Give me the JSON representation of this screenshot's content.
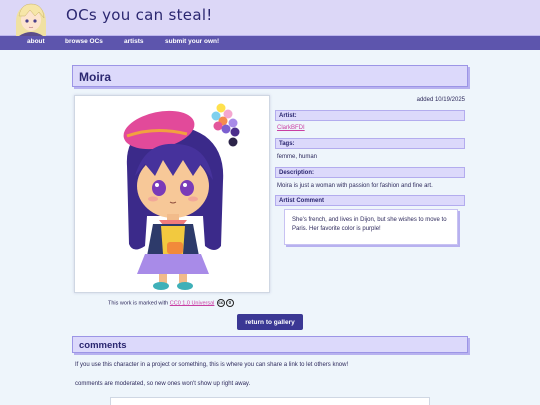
{
  "site": {
    "title": "OCs you can steal!"
  },
  "nav": {
    "items": [
      {
        "label": "about"
      },
      {
        "label": "browse OCs"
      },
      {
        "label": "artists"
      },
      {
        "label": "submit your own!"
      }
    ]
  },
  "oc": {
    "name": "Moira",
    "added": "added 10/19/2025",
    "artist_heading": "Artist:",
    "artist": "ClarkBFDI",
    "tags_heading": "Tags:",
    "tags": "femme, human",
    "description_heading": "Description:",
    "description": "Moira is just a woman with passion for fashion and fine art.",
    "artist_comment_heading": "Artist Comment",
    "artist_comment": "She's french, and lives in Dijon, but she wishes to move to Paris. Her favorite color is purple!",
    "palette": [
      "#ffe14d",
      "#f4a7d0",
      "#7ed0ee",
      "#f58a4e",
      "#a88be8",
      "#e3569b",
      "#7b5fd0",
      "#4b2e8c",
      "#2c2449"
    ]
  },
  "license": {
    "prefix": "This work is marked with",
    "link": "CC0 1.0 Universal",
    "icons": [
      "cc-icon",
      "zero-icon"
    ]
  },
  "gallery_button": "return to gallery",
  "comments": {
    "heading": "comments",
    "note1": "If you use this character in a project or something, this is where you can share a link to let others know!",
    "note2": "comments are moderated, so new ones won't show up right away."
  },
  "colors": {
    "accent": "#5d55ad",
    "header_bg": "#dcd7f7",
    "link": "#c93fa3",
    "button": "#3b3894"
  }
}
